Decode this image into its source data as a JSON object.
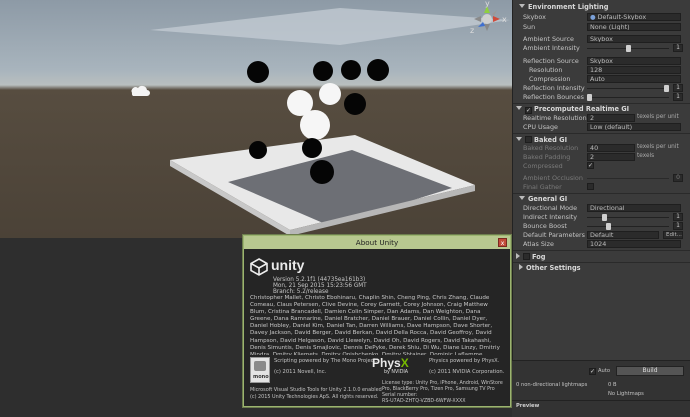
{
  "inspector": {
    "environment": {
      "title": "Environment Lighting",
      "skybox_label": "Skybox",
      "skybox_value": "Default-Skybox",
      "sun_label": "Sun",
      "sun_value": "None (Light)",
      "ambient_source_label": "Ambient Source",
      "ambient_source_value": "Skybox",
      "ambient_intensity_label": "Ambient Intensity",
      "ambient_intensity_value": "1",
      "reflection_source_label": "Reflection Source",
      "reflection_source_value": "Skybox",
      "resolution_label": "Resolution",
      "resolution_value": "128",
      "compression_label": "Compression",
      "compression_value": "Auto",
      "reflection_intensity_label": "Reflection Intensity",
      "reflection_intensity_value": "1",
      "reflection_bounces_label": "Reflection Bounces",
      "reflection_bounces_value": "1"
    },
    "precomputed": {
      "title": "Precomputed Realtime GI",
      "realtime_resolution_label": "Realtime Resolution",
      "realtime_resolution_value": "2",
      "realtime_resolution_unit": "texels per unit",
      "cpu_usage_label": "CPU Usage",
      "cpu_usage_value": "Low (default)"
    },
    "baked": {
      "title": "Baked GI",
      "baked_resolution_label": "Baked Resolution",
      "baked_resolution_value": "40",
      "baked_resolution_unit": "texels per unit",
      "baked_padding_label": "Baked Padding",
      "baked_padding_value": "2",
      "baked_padding_unit": "texels",
      "compressed_label": "Compressed",
      "ambient_occlusion_label": "Ambient Occlusion",
      "ambient_occlusion_value": "0",
      "final_gather_label": "Final Gather"
    },
    "general": {
      "title": "General GI",
      "directional_mode_label": "Directional Mode",
      "directional_mode_value": "Directional",
      "indirect_intensity_label": "Indirect Intensity",
      "indirect_intensity_value": "1",
      "bounce_boost_label": "Bounce Boost",
      "bounce_boost_value": "1",
      "default_parameters_label": "Default Parameters",
      "default_parameters_value": "Default",
      "default_parameters_edit": "Edit...",
      "atlas_size_label": "Atlas Size",
      "atlas_size_value": "1024"
    },
    "fog_title": "Fog",
    "other_settings_title": "Other Settings",
    "auto_label": "Auto",
    "build_label": "Build",
    "lightmaps_label": "0 non-directional lightmaps",
    "lightmaps_size": "0 B",
    "no_lightmaps": "No Lightmaps",
    "preview_label": "Preview"
  },
  "slider_levels": {
    "ambient_intensity": 0.5,
    "reflection_intensity": 1.0,
    "reflection_bounces": 0.0,
    "indirect_intensity": 0.2,
    "bounce_boost": 0.25
  },
  "scene": {
    "gizmo_y": "y",
    "gizmo_x": "x",
    "gizmo_z": "z"
  },
  "about": {
    "title": "About Unity",
    "close": "x",
    "product": "unity",
    "version": "Version 5.2.1f1 (44735ea161b3)",
    "date": "Mon, 21 Sep 2015 15:23:56 GMT",
    "branch": "Branch: 5.2/release",
    "credits": "Christopher Mallet, Christo Ebohinaru, Chaplin Shin, Cheng Ping, Chris Zhang, Claude Comeau, Claus Petersen, Clive Devine, Corey Garnett, Corey Johnson, Craig Matthew Blum, Cristina Brancadell, Damien Colin Simper, Dan Adams, Dan Weighton, Dana Greene, Dana Ramnarine, Daniel Bratcher, Daniel Brauer, Daniel Collin, Daniel Dyer, Daniel Hobley, Daniel Kim, Daniel Tan, Darren Williams, Dave Hampson, Dave Shorter, Davey Jackson, David Berger, David Berkan, David Della Rocca, David Geoffroy, David Hampson, David Helgason, David Llewelyn, David Oh, David Rogers, David Takahashi, Denis Simuntis, Denis Smajlovic, Dennis DePyke, Derek Shiu, Di Wu, Diane Linzy, Dmitriy Mindra, Dmitry Kliemets, Dmitry Onishchenko, Dmitry Shtainer, Dominic Laflamme, Dominic Nsalavang",
    "mono_text": "Scripting powered by The Mono Project.",
    "mono_copyright": "(c) 2011 Novell, Inc.",
    "mono_logo": "mono",
    "physx_word": "Phys",
    "physx_x": "X",
    "nvidia": "by NVIDIA",
    "physics_text": "Physics powered by PhysX.",
    "physics_copyright": "(c) 2011 NVIDIA Corporation.",
    "vstools": "Microsoft Visual Studio Tools for Unity 2.1.0.0 enabled",
    "copyright": "(c) 2015 Unity Technologies ApS. All rights reserved.",
    "license_type": "License type: Unity Pro, iPhone, Android, WinStore Pro, BlackBerry Pro, Tizen Pro, Samsung TV Pro",
    "serial": "Serial number:",
    "serial_value": "RS-U7AD-ZHTQ-VZBD-6WFW-XXXX"
  }
}
